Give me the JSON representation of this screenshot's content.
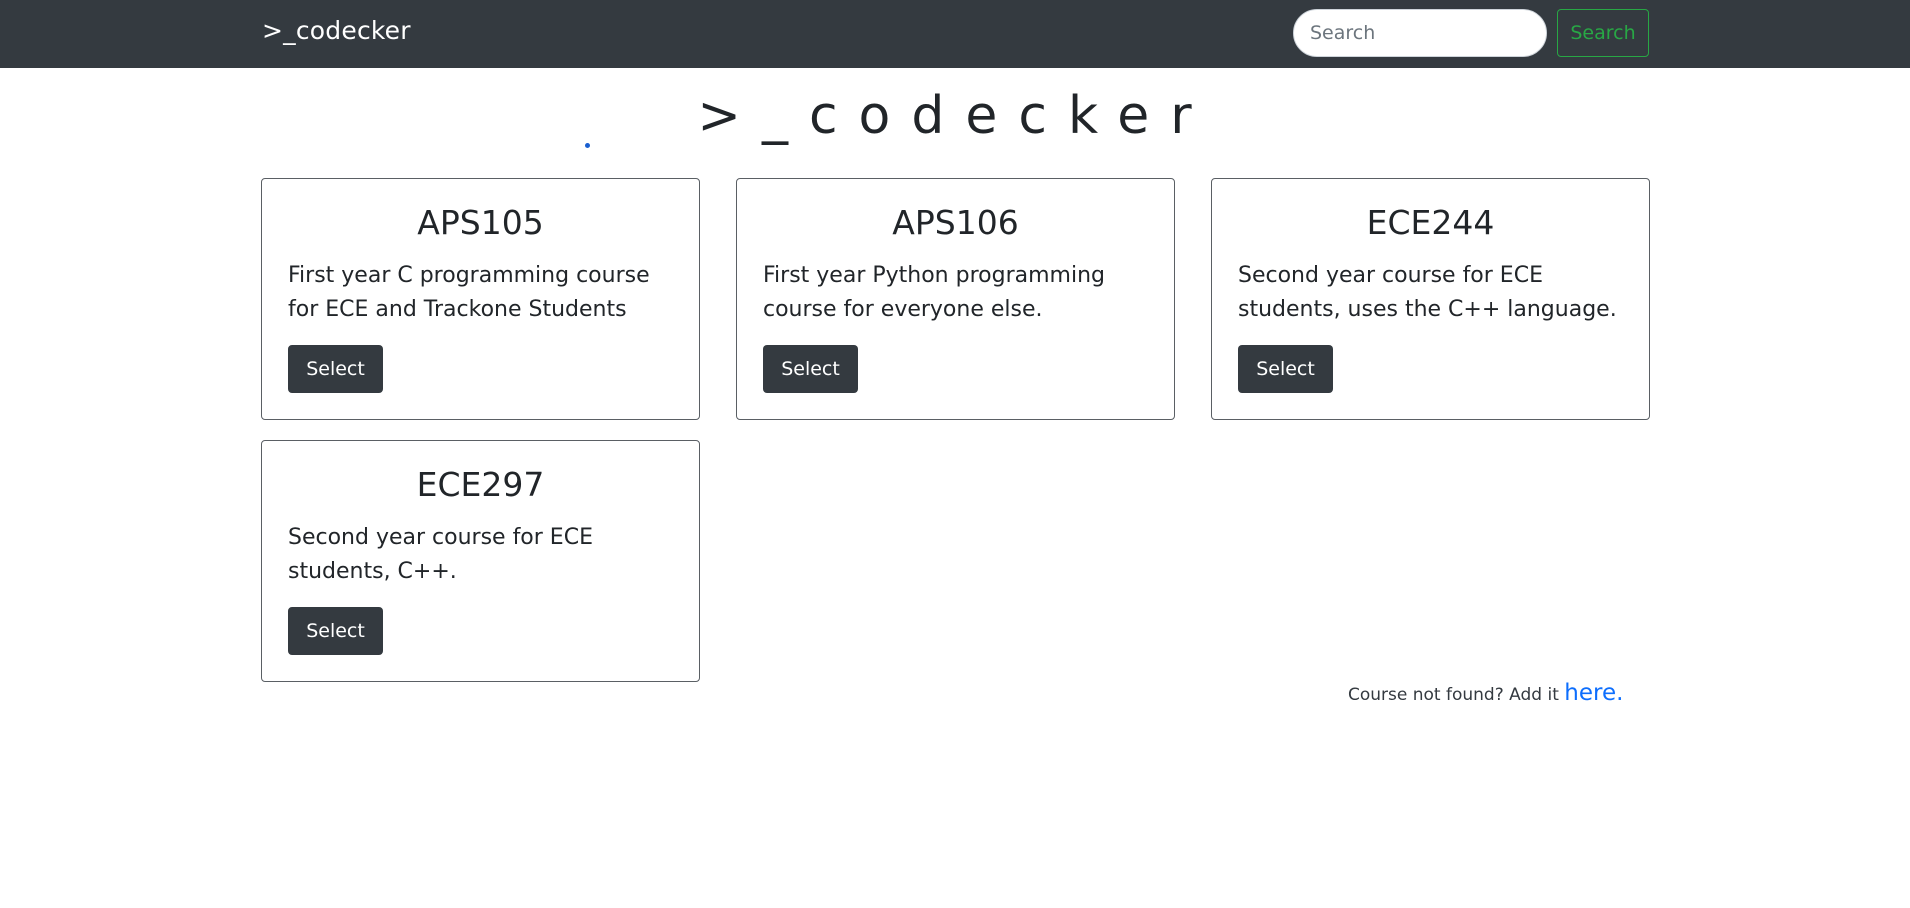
{
  "navbar": {
    "brand": ">_codecker",
    "search_placeholder": "Search",
    "search_button_label": "Search"
  },
  "hero": {
    "title": ">_codecker"
  },
  "courses": [
    {
      "code": "APS105",
      "description": "First year C programming course for ECE and Trackone Students",
      "button_label": "Select"
    },
    {
      "code": "APS106",
      "description": "First year Python programming course for everyone else.",
      "button_label": "Select"
    },
    {
      "code": "ECE244",
      "description": "Second year course for ECE students, uses the C++ language.",
      "button_label": "Select"
    },
    {
      "code": "ECE297",
      "description": "Second year course for ECE students, C++.",
      "button_label": "Select"
    }
  ],
  "footer": {
    "note": "Course not found? Add it ",
    "link_label": "here."
  },
  "colors": {
    "navbar_bg": "#343a40",
    "search_button": "#28a745",
    "link": "#0d6efd"
  }
}
